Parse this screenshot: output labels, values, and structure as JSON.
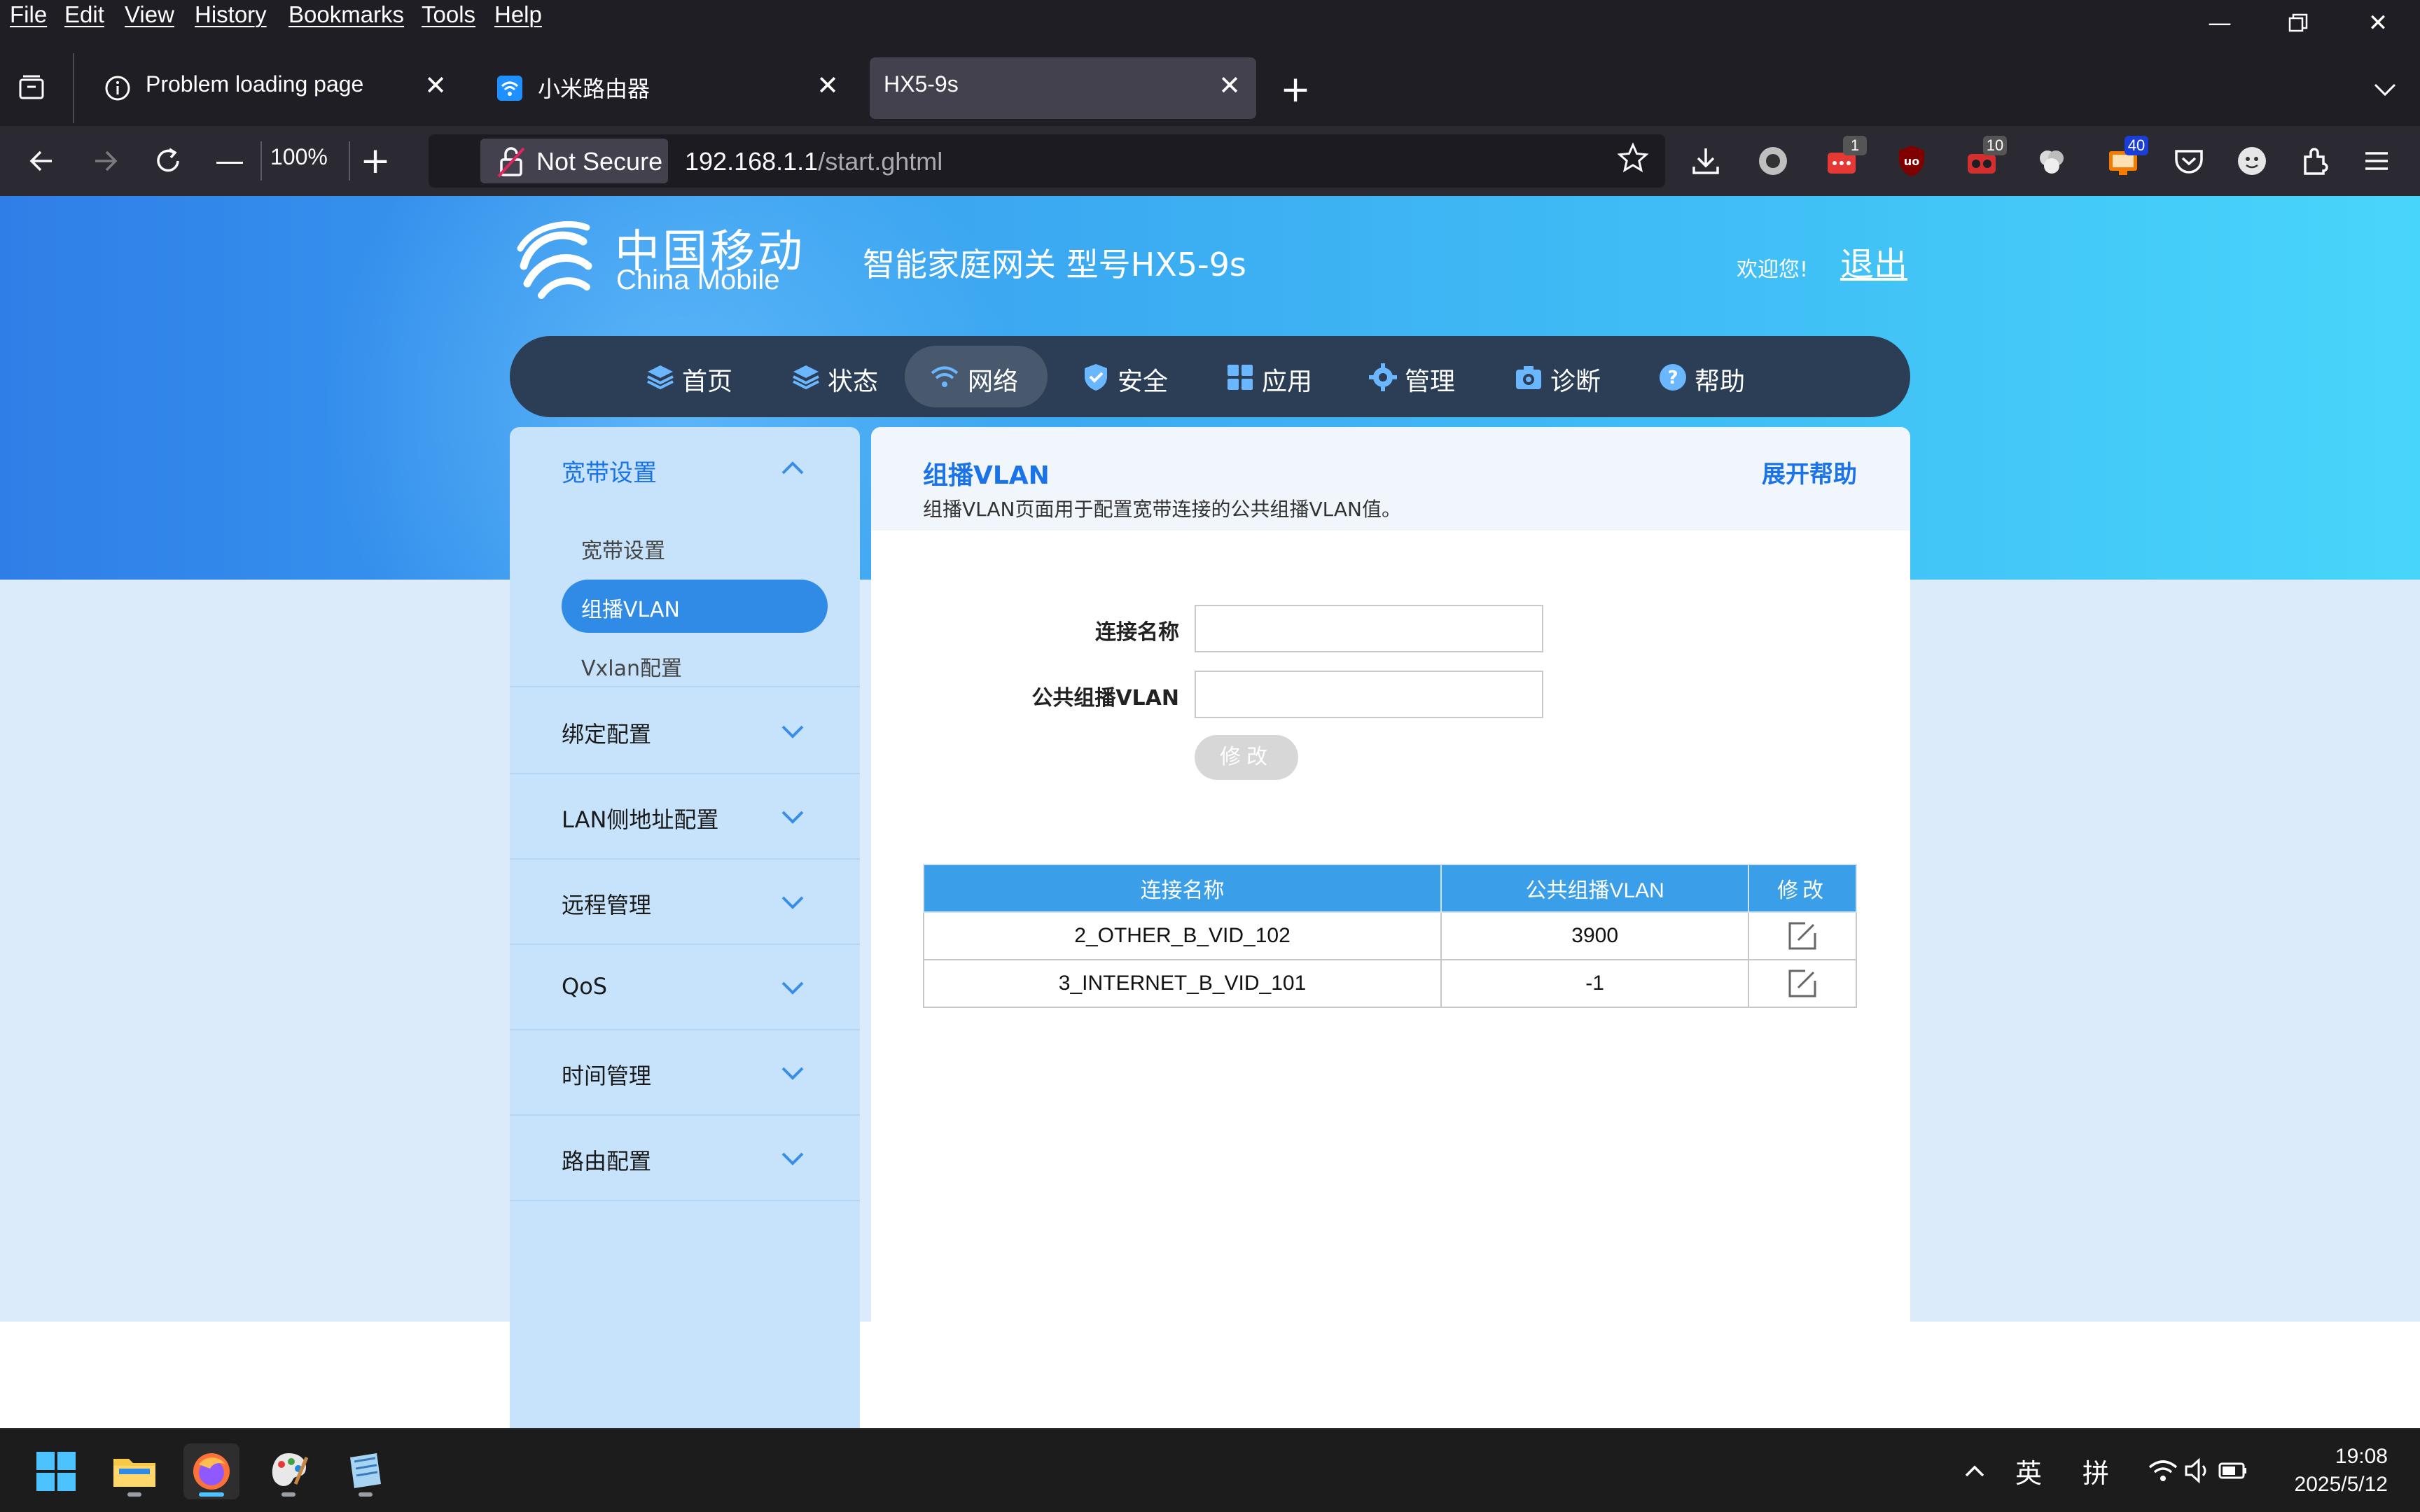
{
  "browser": {
    "menu": [
      "File",
      "Edit",
      "View",
      "History",
      "Bookmarks",
      "Tools",
      "Help"
    ],
    "tabs": [
      {
        "label": "Problem loading page",
        "icon": "info-icon",
        "active": false
      },
      {
        "label": "小米路由器",
        "icon": "wifi-favicon-icon",
        "active": false
      },
      {
        "label": "HX5-9s",
        "icon": "",
        "active": true
      }
    ],
    "zoom": "100%",
    "security_label": "Not Secure",
    "url_host": "192.168.1.1",
    "url_path": "/start.ghtml",
    "extension_badges": {
      "ext_a": "1",
      "ext_c": "10",
      "ext_e": "40"
    },
    "accent_color": "#42414d"
  },
  "header": {
    "logo_cn": "中国移动",
    "logo_en": "China Mobile",
    "product_title": "智能家庭网关 型号HX5-9s",
    "welcome": "欢迎您!",
    "logout": "退出"
  },
  "mainnav": [
    {
      "label": "首页",
      "icon": "layers-icon",
      "active": false
    },
    {
      "label": "状态",
      "icon": "layers-icon",
      "active": false
    },
    {
      "label": "网络",
      "icon": "wifi-icon",
      "active": true
    },
    {
      "label": "安全",
      "icon": "shield-icon",
      "active": false
    },
    {
      "label": "应用",
      "icon": "grid-icon",
      "active": false
    },
    {
      "label": "管理",
      "icon": "gear-icon",
      "active": false
    },
    {
      "label": "诊断",
      "icon": "camera-icon",
      "active": false
    },
    {
      "label": "帮助",
      "icon": "help-icon",
      "active": false
    }
  ],
  "sidebar": {
    "expanded_group": "宽带设置",
    "sub_items": [
      "宽带设置",
      "组播VLAN",
      "Vxlan配置"
    ],
    "active_sub": "组播VLAN",
    "groups": [
      "绑定配置",
      "LAN侧地址配置",
      "远程管理",
      "QoS",
      "时间管理",
      "路由配置"
    ]
  },
  "panel": {
    "title": "组播VLAN",
    "description": "组播VLAN页面用于配置宽带连接的公共组播VLAN值。",
    "help_link": "展开帮助",
    "form": {
      "conn_name_label": "连接名称",
      "conn_name_value": "",
      "vlan_label": "公共组播VLAN",
      "vlan_value": "",
      "modify_button": "修改"
    },
    "table": {
      "headers": [
        "连接名称",
        "公共组播VLAN",
        "修改"
      ],
      "rows": [
        {
          "name": "2_OTHER_B_VID_102",
          "vlan": "3900"
        },
        {
          "name": "3_INTERNET_B_VID_101",
          "vlan": "-1"
        }
      ]
    },
    "accent_color": "#1a73e8",
    "table_header_color": "#3a9ee8"
  },
  "taskbar": {
    "ime_lang": "英",
    "ime_mode": "拼",
    "time": "19:08",
    "date": "2025/5/12"
  }
}
